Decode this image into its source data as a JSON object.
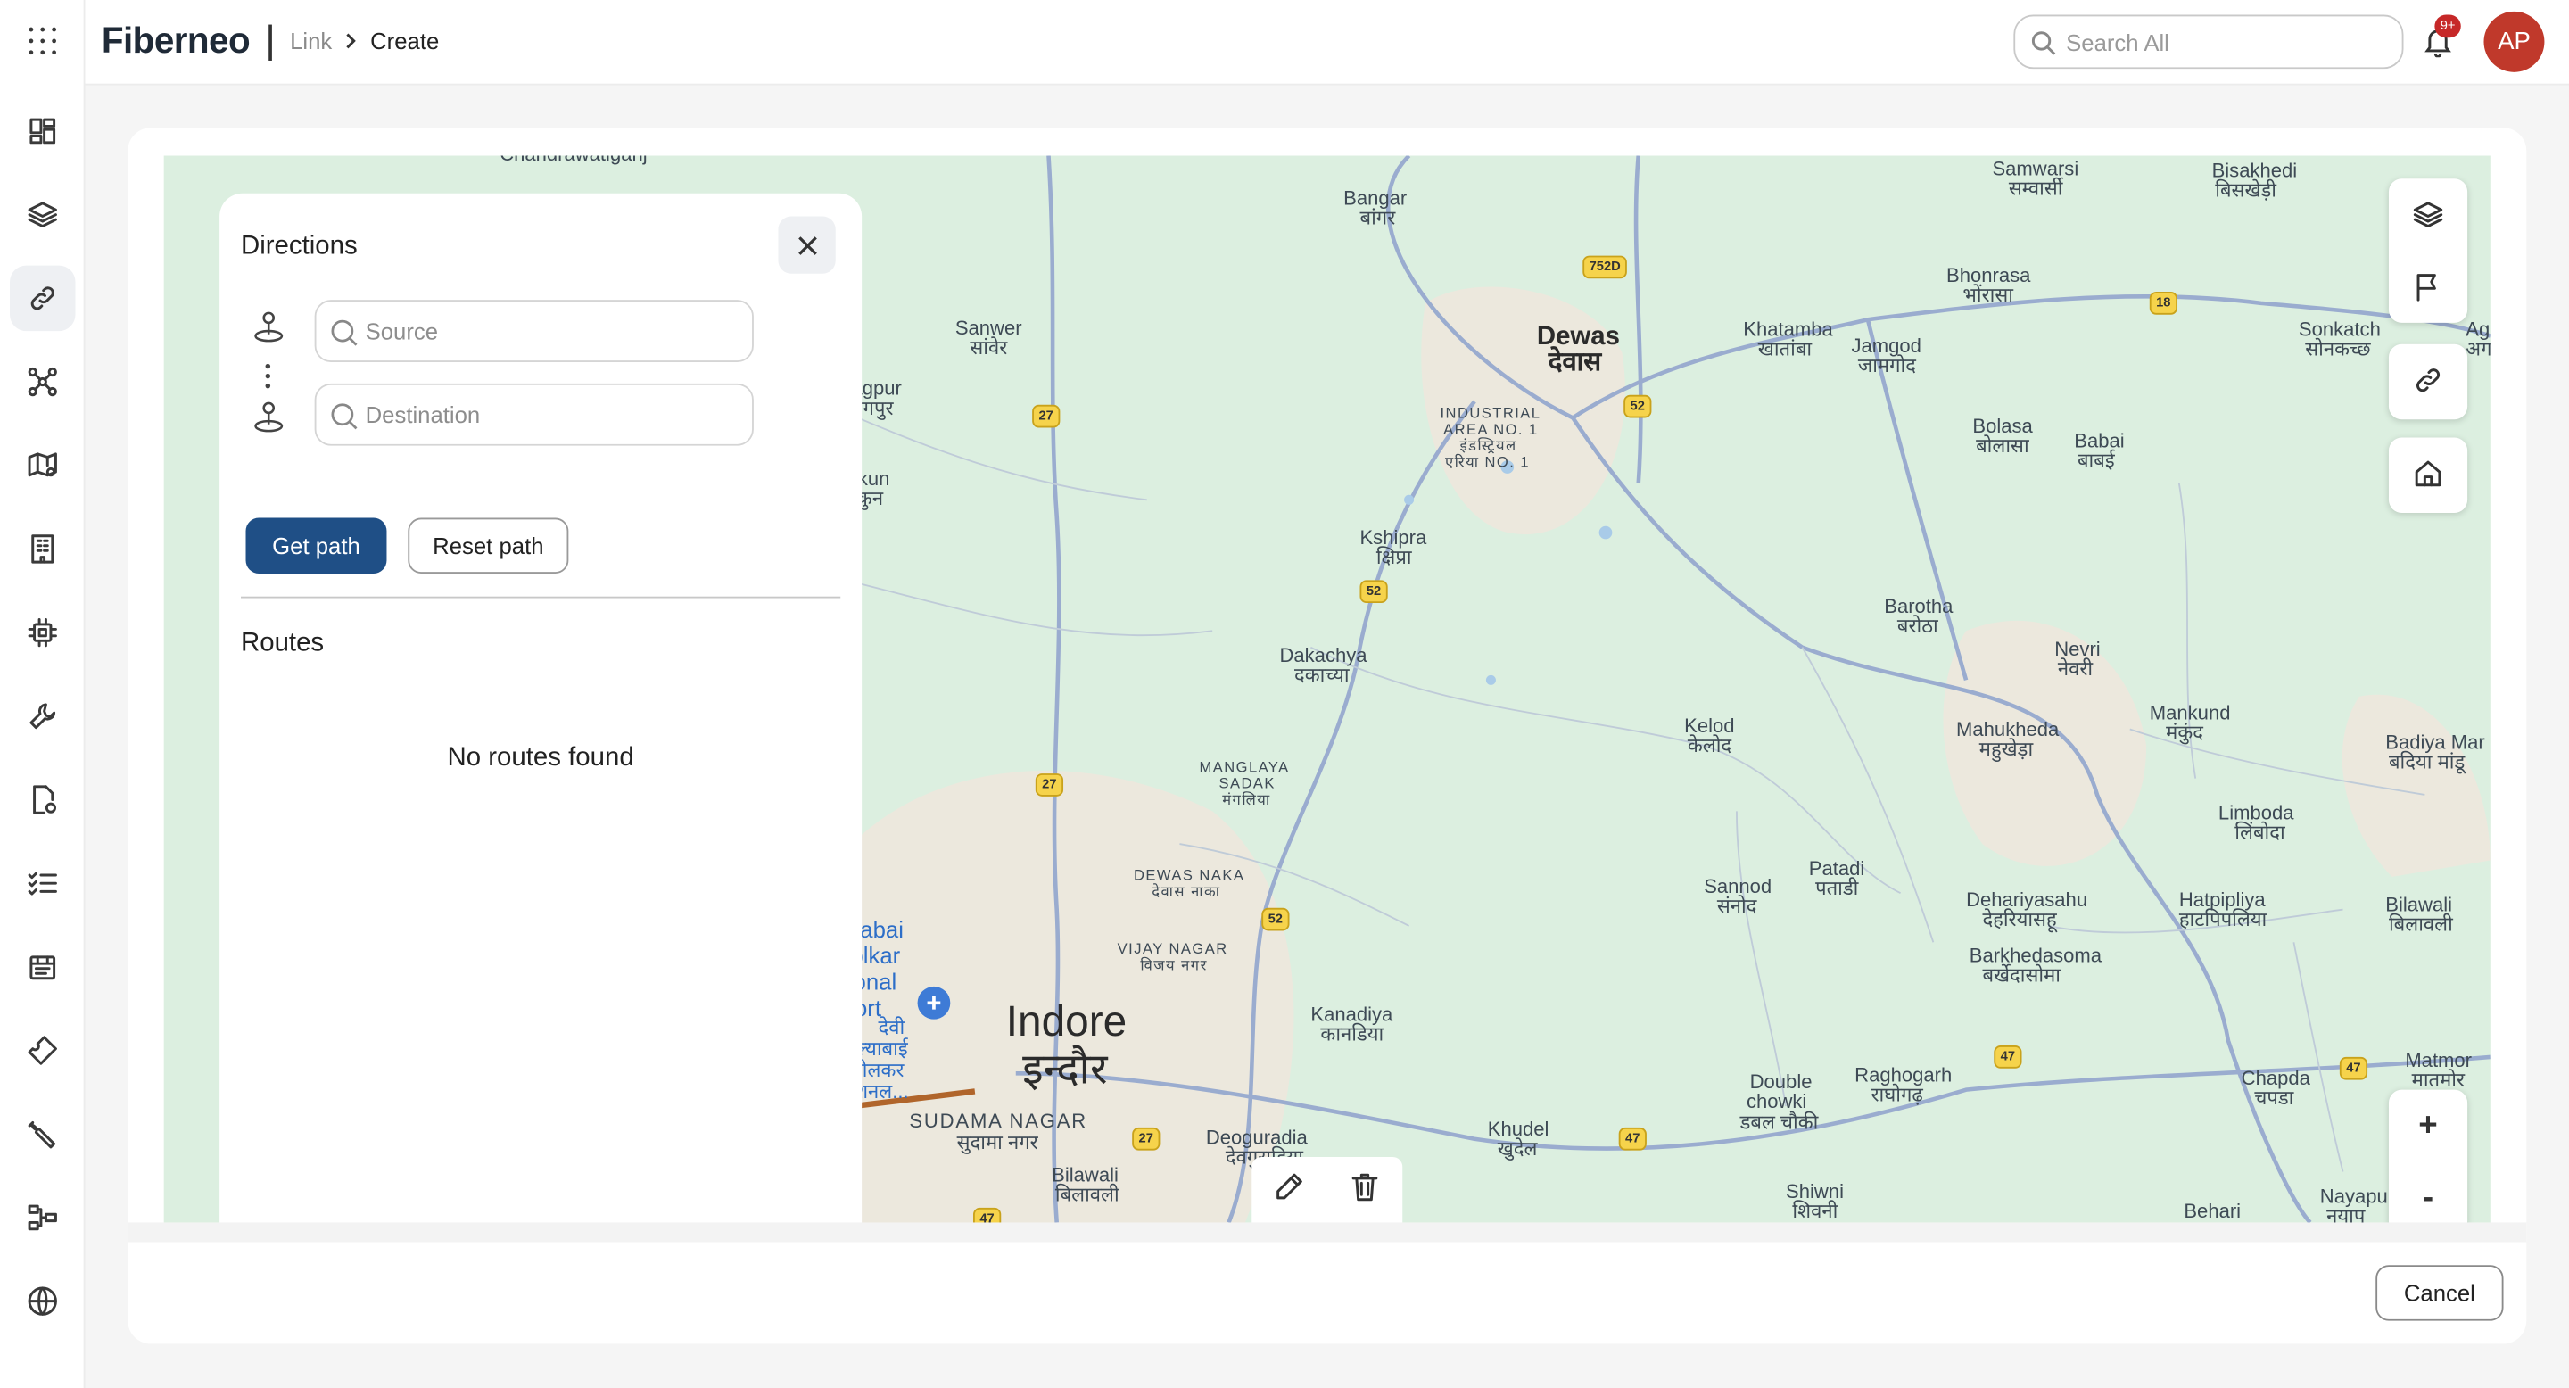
{
  "app": {
    "brand": "Fiberneo"
  },
  "breadcrumb": {
    "parent": "Link",
    "current": "Create"
  },
  "search": {
    "placeholder": "Search All"
  },
  "notifications": {
    "badge": "9+"
  },
  "user": {
    "initials": "AP"
  },
  "sidebar": {
    "items": [
      {
        "icon": "apps-grid-icon"
      },
      {
        "icon": "dashboard-icon"
      },
      {
        "icon": "layers-icon"
      },
      {
        "icon": "link-icon",
        "active": true
      },
      {
        "icon": "network-icon"
      },
      {
        "icon": "map-settings-icon"
      },
      {
        "icon": "building-icon"
      },
      {
        "icon": "chip-icon"
      },
      {
        "icon": "wrench-icon"
      },
      {
        "icon": "document-settings-icon"
      },
      {
        "icon": "checklist-icon"
      },
      {
        "icon": "inventory-icon"
      },
      {
        "icon": "ticket-icon"
      },
      {
        "icon": "tools-icon"
      },
      {
        "icon": "hierarchy-icon"
      },
      {
        "icon": "globe-icon"
      }
    ]
  },
  "directions": {
    "title": "Directions",
    "source_placeholder": "Source",
    "destination_placeholder": "Destination",
    "get_path": "Get path",
    "reset_path": "Reset path",
    "routes_title": "Routes",
    "empty_message": "No routes found"
  },
  "map": {
    "labels": {
      "bangar": "Bangar",
      "bangar_hi": "बांगर",
      "samwarsi": "Samwarsi",
      "samwarsi_hi": "सम्वार्सी",
      "bisakhedi": "Bisakhedi",
      "bisakhedi_hi": "बिसखेड़ी",
      "bhonrasa": "Bhonrasa",
      "bhonrasa_hi": "भोंरासा",
      "dewas": "Dewas",
      "dewas_hi": "देवास",
      "khatamba": "Khatamba",
      "khatamba_hi": "खातांबा",
      "jamgod": "Jamgod",
      "jamgod_hi": "जामगोद",
      "sonkatch": "Sonkatch",
      "sonkatch_hi": "सोनकच्छ",
      "sanwer": "Sanwer",
      "sanwer_hi": "सांवेर",
      "nagpur": "Nagpur",
      "nagpur_hi": "नागपुर",
      "industrial": "INDUSTRIAL",
      "area_no1": "AREA NO. 1",
      "industrial_hi": "इंडस्ट्रियल",
      "area_no1_hi": "एरिया NO. 1",
      "bolasa": "Bolasa",
      "bolasa_hi": "बोलासा",
      "babai": "Babai",
      "babai_hi": "बाबई",
      "takun": "Takun",
      "takun_hi": "टाकुन",
      "kshipra": "Kshipra",
      "kshipra_hi": "क्षिप्रा",
      "barotha": "Barotha",
      "barotha_hi": "बरोठा",
      "nevri": "Nevri",
      "nevri_hi": "नेवरी",
      "dakachya": "Dakachya",
      "dakachya_hi": "दकाच्या",
      "kelod": "Kelod",
      "kelod_hi": "केलोद",
      "mahukheda": "Mahukheda",
      "mahukheda_hi": "महुखेड़ा",
      "mankund": "Mankund",
      "mankund_hi": "मंकुंद",
      "badiya": "Badiya Mar",
      "badiya_hi": "बदिया मांडू",
      "manglaya": "MANGLAYA",
      "sadak": "SADAK",
      "manglaya_hi": "मंगलिया",
      "limboda": "Limboda",
      "limboda_hi": "लिंबोदा",
      "dewas_naka": "DEWAS NAKA",
      "dewas_naka_hi": "देवास नाका",
      "sannod": "Sannod",
      "sannod_hi": "संनोद",
      "patadi": "Patadi",
      "patadi_hi": "पताडी",
      "dehariyasahu": "Dehariyasahu",
      "dehariyasahu_hi": "देहरियासहू",
      "hatpipliya": "Hatpipliya",
      "hatpipliya_hi": "हाटपिपलिया",
      "bilawali_r": "Bilawali",
      "bilawali_r_hi": "बिलावली",
      "vijay_nagar": "VIJAY NAGAR",
      "vijay_nagar_hi": "विजय नगर",
      "barkhedasoma": "Barkhedasoma",
      "barkhedasoma_hi": "बर्खेदासोमा",
      "airport1": "hilyabai",
      "airport2": "Holkar",
      "airport3": "ational",
      "airport4": "irport",
      "airport_hi1": "देवी",
      "airport_hi2": "अहिल्याबाई",
      "airport_hi3": "होलकर",
      "airport_hi4": "टरनेशनल...",
      "indore": "Indore",
      "indore_hi": "इन्दौर",
      "kanadiya": "Kanadiya",
      "kanadiya_hi": "कानडिया",
      "matmor": "Matmor",
      "matmor_hi": "मातमोर",
      "sudama_nagar": "SUDAMA NAGAR",
      "sudama_nagar_hi": "सुदामा नगर",
      "double_chowki": "Double",
      "chowki": "chowki",
      "double_chowki_hi": "डबल चौकी",
      "raghogarh": "Raghogarh",
      "raghogarh_hi": "राघोगढ़",
      "chapda": "Chapda",
      "chapda_hi": "चपडा",
      "deoguradia": "Deoguradia",
      "deoguradia_hi": "देवगुराड़िया",
      "khudel": "Khudel",
      "khudel_hi": "खुदेल",
      "bilawali": "Bilawali",
      "bilawali_hi": "बिलावली",
      "shiwni": "Shiwni",
      "shiwni_hi": "शिवनी",
      "behari": "Behari",
      "nayapu": "Nayapu",
      "nayapu_hi": "नयापु",
      "chandrawatiganj": "Chandrawatiganj",
      "age": "Age",
      "age_hi": "अग"
    },
    "shields": {
      "r752d": "752D",
      "r18": "18",
      "r27a": "27",
      "r52a": "52",
      "r52b": "52",
      "r27b": "27",
      "r52c": "52",
      "r47a": "47",
      "r47b": "47",
      "r47c": "47",
      "r27c": "27",
      "r47d": "47"
    },
    "controls": [
      "layers-icon",
      "flag-icon",
      "link-icon",
      "home-icon"
    ],
    "zoom_in": "+",
    "zoom_out": "-"
  },
  "footer": {
    "cancel": "Cancel"
  }
}
